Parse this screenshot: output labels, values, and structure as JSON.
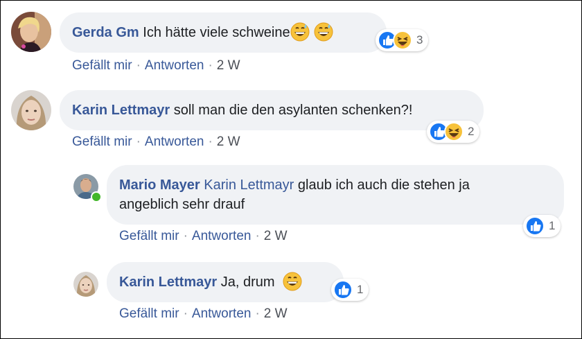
{
  "colors": {
    "author": "#385898",
    "bubble": "#f0f2f5",
    "like": "#1877f2",
    "online": "#42b72a"
  },
  "comments": [
    {
      "author": "Gerda Gm",
      "text": "Ich hätte viele schweine",
      "emojis": [
        "grinning-sweat-emoji",
        "grinning-sweat-emoji"
      ],
      "reactions": {
        "icons": [
          "like-icon",
          "laugh-icon"
        ],
        "count": "3"
      },
      "actions": {
        "like": "Gefällt mir",
        "reply": "Antworten",
        "time": "2 W"
      }
    },
    {
      "author": "Karin Lettmayr",
      "text": "soll man die den asylanten schenken?!",
      "reactions": {
        "icons": [
          "like-icon",
          "laugh-icon"
        ],
        "count": "2"
      },
      "actions": {
        "like": "Gefällt mir",
        "reply": "Antworten",
        "time": "2 W"
      }
    },
    {
      "author": "Mario Mayer",
      "mention": "Karin Lettmayr",
      "text_line1": "glaub ich auch die stehen ja",
      "text_line2": "angeblich sehr drauf",
      "online": true,
      "reactions": {
        "icons": [
          "like-icon"
        ],
        "count": "1"
      },
      "actions": {
        "like": "Gefällt mir",
        "reply": "Antworten",
        "time": "2 W"
      }
    },
    {
      "author": "Karin Lettmayr",
      "text": "Ja, drum",
      "emojis": [
        "grinning-emoji"
      ],
      "reactions": {
        "icons": [
          "like-icon"
        ],
        "count": "1"
      },
      "actions": {
        "like": "Gefällt mir",
        "reply": "Antworten",
        "time": "2 W"
      }
    }
  ]
}
